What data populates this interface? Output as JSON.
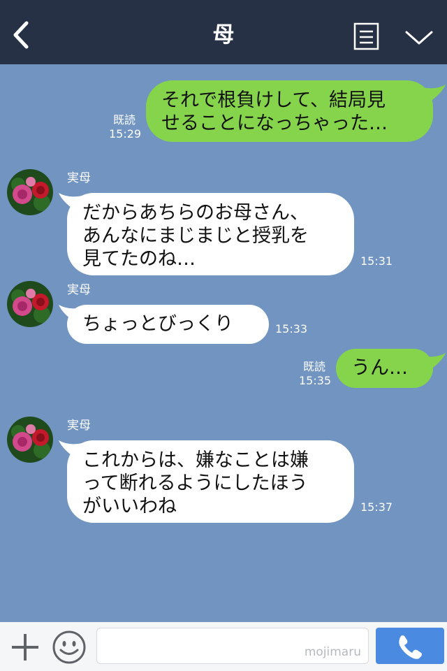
{
  "header": {
    "title": "母",
    "back_icon": "chevron-left-icon",
    "menu_icon": "notes-menu-icon",
    "expand_icon": "chevron-down-icon"
  },
  "messages": [
    {
      "direction": "out",
      "text": "それで根負けして、結局見\nせることになっちゃった…",
      "read": "既読",
      "time": "15:29"
    },
    {
      "direction": "in",
      "sender": "実母",
      "text": "だからあちらのお母さん、\nあんなにまじまじと授乳を\n見てたのね…",
      "time": "15:31"
    },
    {
      "direction": "in",
      "sender": "実母",
      "text": "ちょっとびっくり",
      "time": "15:33"
    },
    {
      "direction": "out",
      "text": "うん…",
      "read": "既読",
      "time": "15:35"
    },
    {
      "direction": "in",
      "sender": "実母",
      "text": "これからは、嫌なことは嫌\nって断れるようにしたほう\nがいいわね",
      "time": "15:37"
    }
  ],
  "footer": {
    "input_value": "",
    "watermark": "mojimaru",
    "plus_icon": "plus-icon",
    "emoji_icon": "smiley-icon",
    "call_icon": "phone-icon"
  },
  "colors": {
    "background": "#7194c1",
    "header": "#263146",
    "outgoing_bubble": "#85d44b",
    "incoming_bubble": "#ffffff",
    "call_button": "#4a8ae0"
  }
}
